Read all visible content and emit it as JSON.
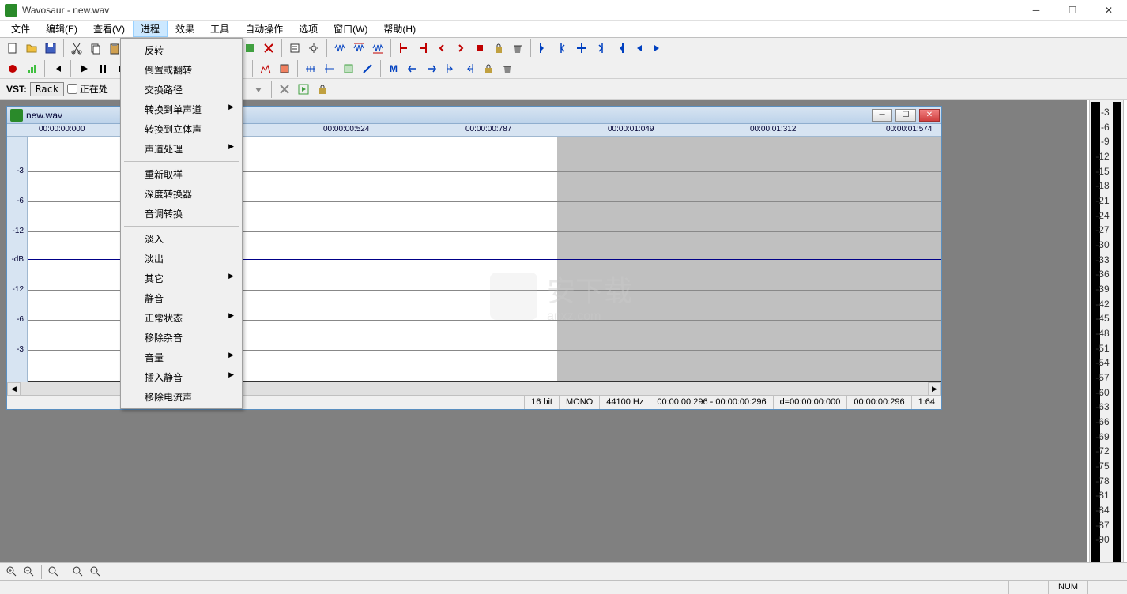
{
  "window": {
    "title": "Wavosaur - new.wav"
  },
  "menubar": [
    "文件",
    "编辑(E)",
    "查看(V)",
    "进程",
    "效果",
    "工具",
    "自动操作",
    "选项",
    "窗口(W)",
    "帮助(H)"
  ],
  "activeMenuIndex": 3,
  "dropdown": {
    "items": [
      {
        "label": "反转",
        "sub": false
      },
      {
        "label": "倒置或翻转",
        "sub": false
      },
      {
        "label": "交换路径",
        "sub": false
      },
      {
        "label": "转换到单声道",
        "sub": true
      },
      {
        "label": "转换到立体声",
        "sub": false
      },
      {
        "label": "声道处理",
        "sub": true
      },
      {
        "sep": true
      },
      {
        "label": "重新取样",
        "sub": false
      },
      {
        "label": "深度转换器",
        "sub": false
      },
      {
        "label": "音调转换",
        "sub": false
      },
      {
        "sep": true
      },
      {
        "label": "淡入",
        "sub": false
      },
      {
        "label": "淡出",
        "sub": false
      },
      {
        "label": "其它",
        "sub": true
      },
      {
        "label": "静音",
        "sub": false
      },
      {
        "label": "正常状态",
        "sub": true
      },
      {
        "label": "移除杂音",
        "sub": false
      },
      {
        "label": "音量",
        "sub": true
      },
      {
        "label": "插入静音",
        "sub": true
      },
      {
        "label": "移除电流声",
        "sub": false
      }
    ]
  },
  "vst": {
    "label": "VST:",
    "rack": "Rack",
    "checkbox": "正在处"
  },
  "child": {
    "title": "new.wav",
    "timeline": [
      "00:00:00:000",
      "00:00:00:524",
      "00:00:00:787",
      "00:00:01:049",
      "00:00:01:312",
      "00:00:01:574"
    ],
    "scale": [
      "-3",
      "-6",
      "-12",
      "-dB",
      "-12",
      "-6",
      "-3"
    ],
    "status": {
      "bits": "16 bit",
      "channels": "MONO",
      "rate": "44100 Hz",
      "range": "00:00:00:296 - 00:00:00:296",
      "delta": "d=00:00:00:000",
      "pos": "00:00:00:296",
      "zoom": "1:64"
    }
  },
  "meterScale": [
    "-3",
    "-6",
    "-9",
    "-12",
    "-15",
    "-18",
    "-21",
    "-24",
    "-27",
    "-30",
    "-33",
    "-36",
    "-39",
    "-42",
    "-45",
    "-48",
    "-51",
    "-54",
    "-57",
    "-60",
    "-63",
    "-66",
    "-69",
    "-72",
    "-75",
    "-78",
    "-81",
    "-84",
    "-87",
    "-90"
  ],
  "statusbar": {
    "num": "NUM"
  },
  "watermark": {
    "t1": "安下载",
    "t2": "anxz.com"
  }
}
